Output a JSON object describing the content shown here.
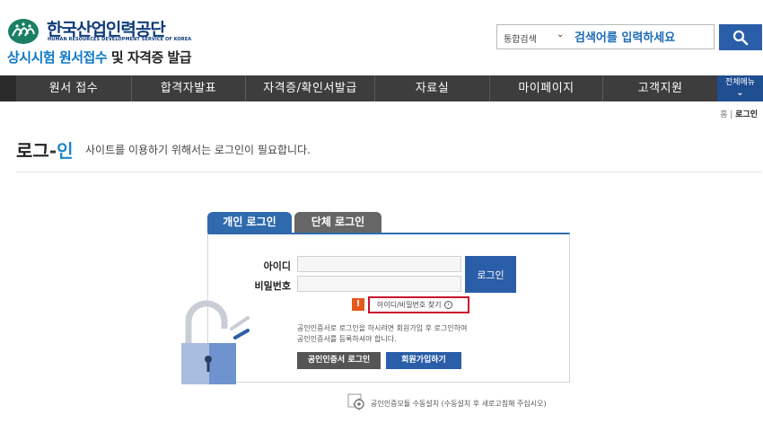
{
  "header": {
    "org_name_ko": "한국산업인력공단",
    "org_name_en": "HUMAN RESOURCES DEVELOPMENT SERVICE OF KOREA",
    "subtitle_blue": "상시시험 원서접수",
    "subtitle_dark": " 및 자격증 발급"
  },
  "search": {
    "scope": "통합검색",
    "placeholder": "검색어를 입력하세요"
  },
  "nav": {
    "items": [
      "원서 접수",
      "합격자발표",
      "자격증/확인서발급",
      "자료실",
      "마이페이지",
      "고객지원"
    ],
    "all_menu": "전체메뉴"
  },
  "breadcrumb": {
    "home": "홈",
    "sep": "|",
    "current": "로그인"
  },
  "page": {
    "title_a": "로그",
    "title_dash": "-",
    "title_b": "인",
    "description": "사이트를 이용하기 위해서는 로그인이 필요합니다."
  },
  "login": {
    "tab_personal": "개인 로그인",
    "tab_group": "단체 로그인",
    "id_label": "아이디",
    "pw_label": "비밀번호",
    "submit": "로그인",
    "help_mark": "!",
    "find_link": "아이디/비밀번호 찾기",
    "cert_note_line1": "공인인증서로 로그인을 하시려면 회원가입 후 로그인하여",
    "cert_note_line2": "공인인증서를 등록하셔야 합니다.",
    "cert_login": "공인인증서 로그인",
    "join": "회원가입하기",
    "install_note": "공인인증모듈 수동설치 (수동설치 후 새로고침해 주십시오)"
  },
  "colors": {
    "primary": "#2a5ea8",
    "nav_bg": "#3d3d3d",
    "accent_orange": "#e45a1a",
    "highlight_red": "#c8102e"
  }
}
